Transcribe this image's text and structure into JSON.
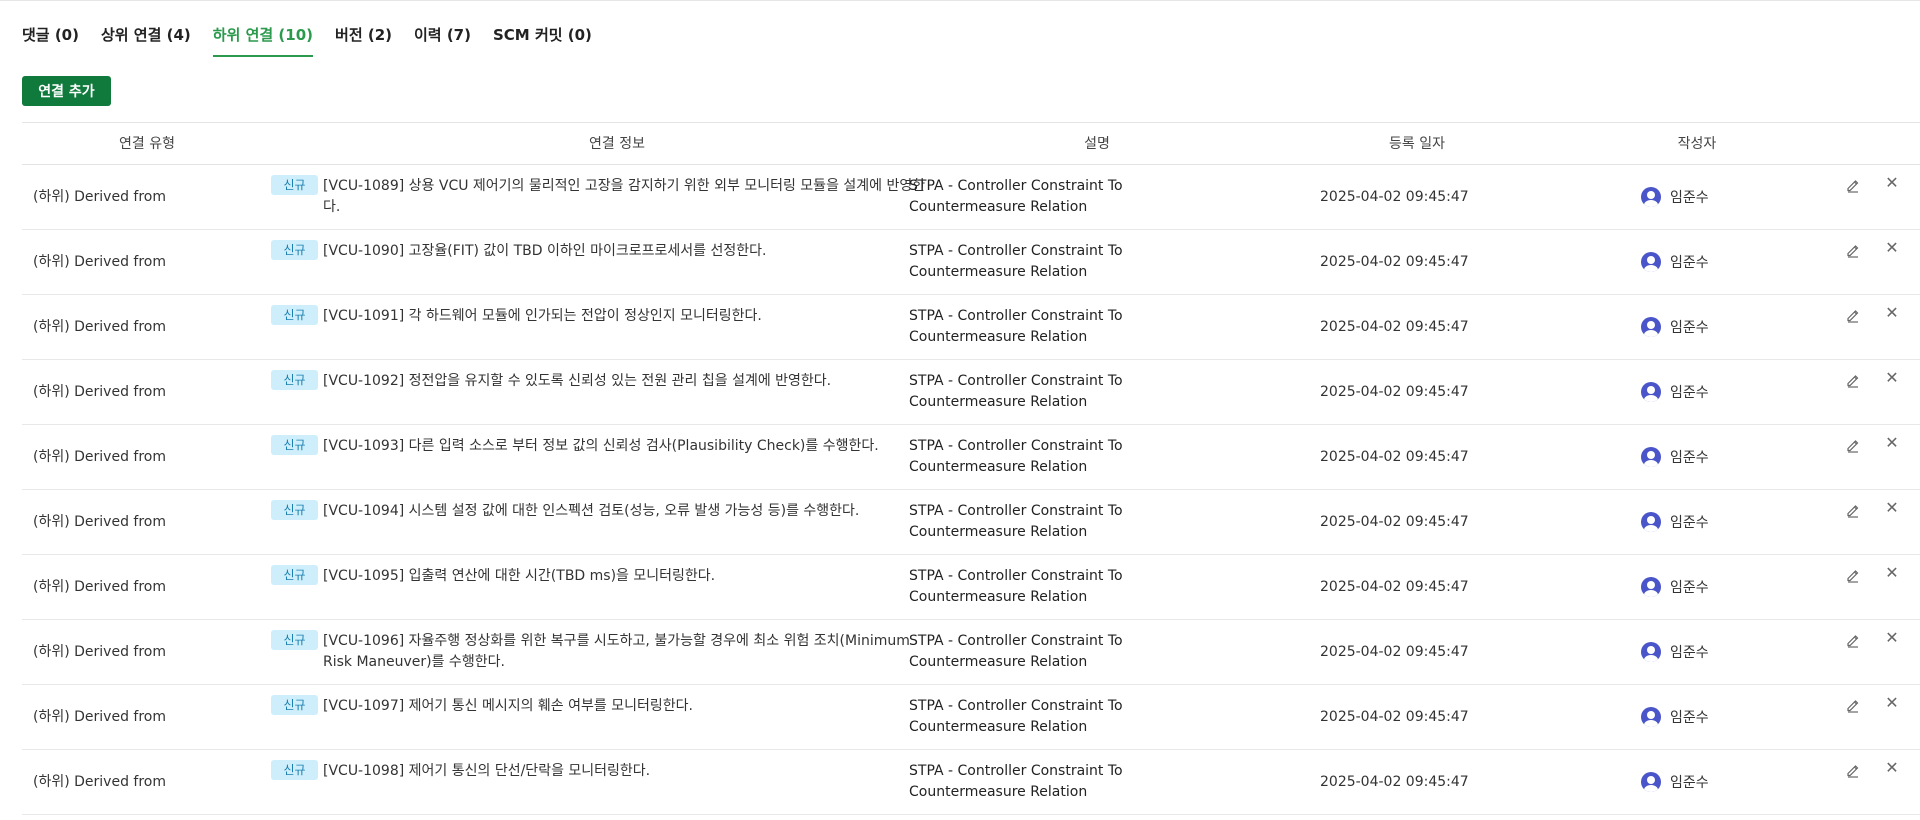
{
  "tabs": [
    {
      "label": "댓글 (0)",
      "active": false
    },
    {
      "label": "상위 연결 (4)",
      "active": false
    },
    {
      "label": "하위 연결 (10)",
      "active": true
    },
    {
      "label": "버전 (2)",
      "active": false
    },
    {
      "label": "이력 (7)",
      "active": false
    },
    {
      "label": "SCM 커밋 (0)",
      "active": false
    }
  ],
  "add_button_label": "연결 추가",
  "columns": {
    "type": "연결 유형",
    "info": "연결 정보",
    "desc": "설명",
    "date": "등록 일자",
    "author": "작성자"
  },
  "rows": [
    {
      "type": "(하위) Derived from",
      "badge": "신규",
      "info": "[VCU-1089] 상용 VCU 제어기의 물리적인 고장을 감지하기 위한 외부 모니터링 모듈을 설계에 반영한다.",
      "desc": "STPA - Controller Constraint To Countermeasure Relation",
      "date": "2025-04-02 09:45:47",
      "author": "임준수"
    },
    {
      "type": "(하위) Derived from",
      "badge": "신규",
      "info": "[VCU-1090] 고장율(FIT) 값이 TBD 이하인 마이크로프로세서를 선정한다.",
      "desc": "STPA - Controller Constraint To Countermeasure Relation",
      "date": "2025-04-02 09:45:47",
      "author": "임준수"
    },
    {
      "type": "(하위) Derived from",
      "badge": "신규",
      "info": "[VCU-1091] 각 하드웨어 모듈에 인가되는 전압이 정상인지 모니터링한다.",
      "desc": "STPA - Controller Constraint To Countermeasure Relation",
      "date": "2025-04-02 09:45:47",
      "author": "임준수"
    },
    {
      "type": "(하위) Derived from",
      "badge": "신규",
      "info": "[VCU-1092] 정전압을 유지할 수 있도록 신뢰성 있는 전원 관리 칩을 설계에 반영한다.",
      "desc": "STPA - Controller Constraint To Countermeasure Relation",
      "date": "2025-04-02 09:45:47",
      "author": "임준수"
    },
    {
      "type": "(하위) Derived from",
      "badge": "신규",
      "info": "[VCU-1093] 다른 입력 소스로 부터 정보 값의 신뢰성 검사(Plausibility Check)를 수행한다.",
      "desc": "STPA - Controller Constraint To Countermeasure Relation",
      "date": "2025-04-02 09:45:47",
      "author": "임준수"
    },
    {
      "type": "(하위) Derived from",
      "badge": "신규",
      "info": "[VCU-1094] 시스템 설정 값에 대한 인스펙션 검토(성능, 오류 발생 가능성 등)를 수행한다.",
      "desc": "STPA - Controller Constraint To Countermeasure Relation",
      "date": "2025-04-02 09:45:47",
      "author": "임준수"
    },
    {
      "type": "(하위) Derived from",
      "badge": "신규",
      "info": "[VCU-1095] 입출력 연산에 대한 시간(TBD ms)을 모니터링한다.",
      "desc": "STPA - Controller Constraint To Countermeasure Relation",
      "date": "2025-04-02 09:45:47",
      "author": "임준수"
    },
    {
      "type": "(하위) Derived from",
      "badge": "신규",
      "info": "[VCU-1096] 자율주행 정상화를 위한 복구를 시도하고, 불가능할 경우에 최소 위험 조치(Minimum Risk Maneuver)를 수행한다.",
      "desc": "STPA - Controller Constraint To Countermeasure Relation",
      "date": "2025-04-02 09:45:47",
      "author": "임준수"
    },
    {
      "type": "(하위) Derived from",
      "badge": "신규",
      "info": "[VCU-1097] 제어기 통신 메시지의 훼손 여부를 모니터링한다.",
      "desc": "STPA - Controller Constraint To Countermeasure Relation",
      "date": "2025-04-02 09:45:47",
      "author": "임준수"
    },
    {
      "type": "(하위) Derived from",
      "badge": "신규",
      "info": "[VCU-1098] 제어기 통신의 단선/단락을 모니터링한다.",
      "desc": "STPA - Controller Constraint To Countermeasure Relation",
      "date": "2025-04-02 09:45:47",
      "author": "임준수"
    }
  ]
}
